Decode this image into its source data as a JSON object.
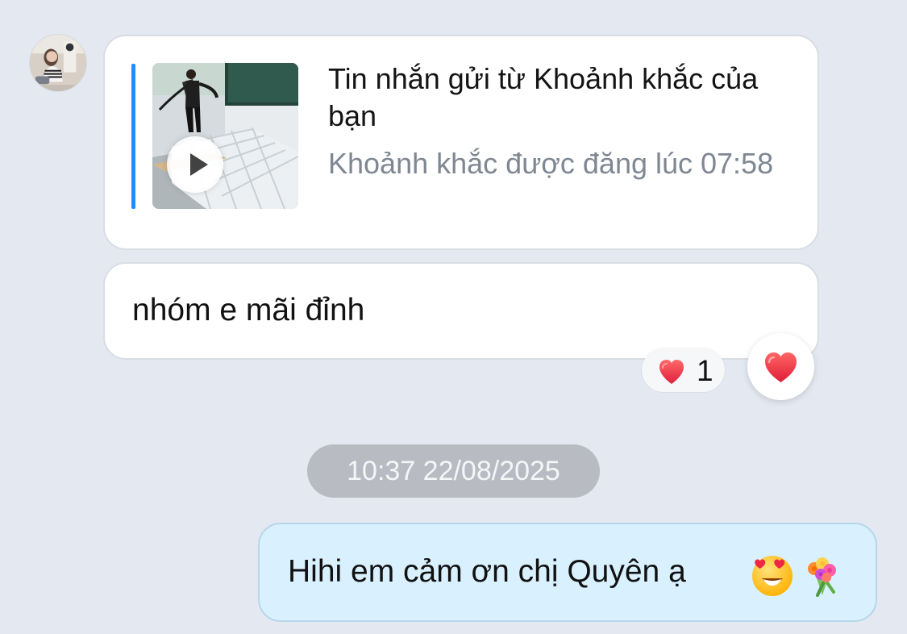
{
  "avatar": {
    "icon": "profile-avatar"
  },
  "moment_card": {
    "title": "Tin nhắn gửi từ Khoảnh khắc của bạn",
    "subtitle": "Khoảnh khắc được đăng lúc 07:58",
    "accent_color": "#1f8cff"
  },
  "incoming_message": {
    "text": "nhóm e mãi đỉnh"
  },
  "reactions": {
    "count": "1",
    "icon": "heart-icon"
  },
  "timestamp": {
    "text": "10:37 22/08/2025"
  },
  "outgoing_message": {
    "text": "Hihi em cảm ơn chị Quyên ạ",
    "bubble_color": "#d9f0ff"
  }
}
